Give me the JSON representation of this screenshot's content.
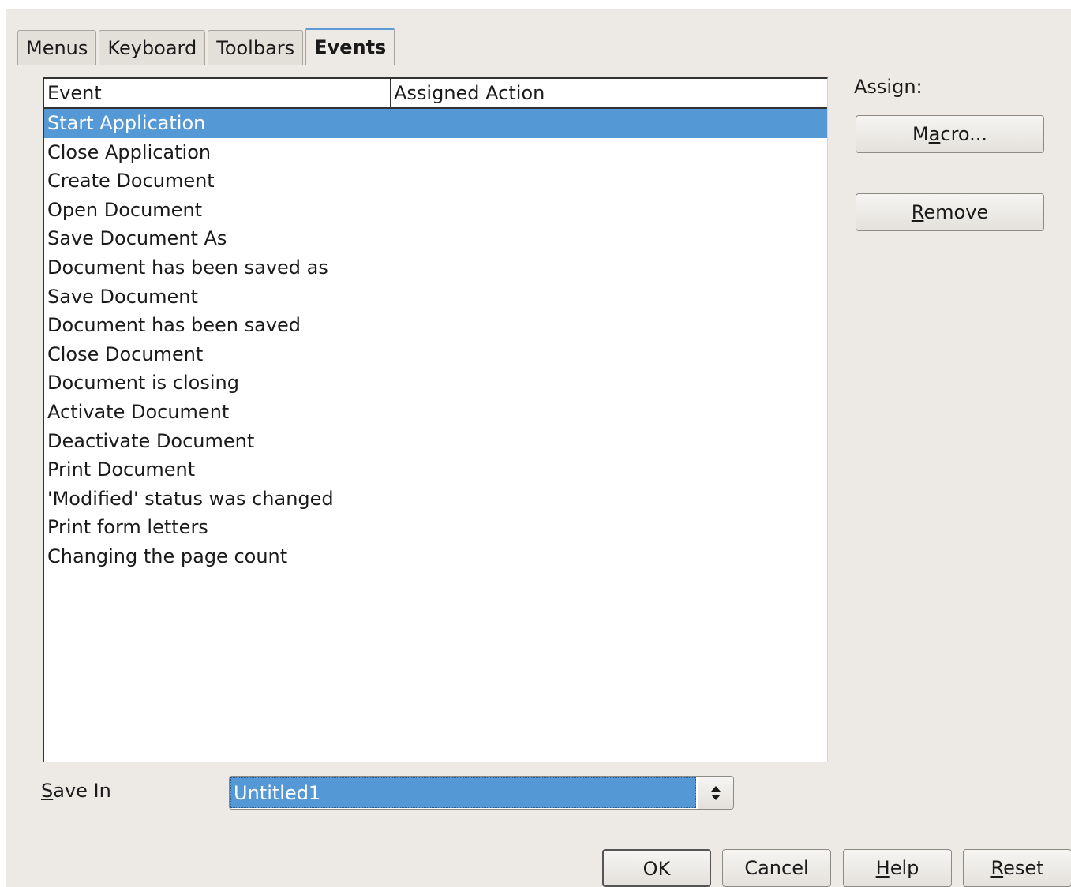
{
  "tabs": [
    {
      "label": "Menus",
      "active": false
    },
    {
      "label": "Keyboard",
      "active": false
    },
    {
      "label": "Toolbars",
      "active": false
    },
    {
      "label": "Events",
      "active": true
    }
  ],
  "event_list": {
    "columns": [
      "Event",
      "Assigned Action"
    ],
    "rows": [
      {
        "event": "Start Application",
        "action": "",
        "selected": true
      },
      {
        "event": "Close Application",
        "action": ""
      },
      {
        "event": "Create Document",
        "action": ""
      },
      {
        "event": "Open Document",
        "action": ""
      },
      {
        "event": "Save Document As",
        "action": ""
      },
      {
        "event": "Document has been saved as",
        "action": ""
      },
      {
        "event": "Save Document",
        "action": ""
      },
      {
        "event": "Document has been saved",
        "action": ""
      },
      {
        "event": "Close Document",
        "action": ""
      },
      {
        "event": "Document is closing",
        "action": ""
      },
      {
        "event": "Activate Document",
        "action": ""
      },
      {
        "event": "Deactivate Document",
        "action": ""
      },
      {
        "event": "Print Document",
        "action": ""
      },
      {
        "event": "'Modified' status was changed",
        "action": ""
      },
      {
        "event": "Print form letters",
        "action": ""
      },
      {
        "event": "Changing the page count",
        "action": ""
      }
    ]
  },
  "assign": {
    "label": "Assign:",
    "macro_pre": "M",
    "macro_u": "a",
    "macro_post": "cro...",
    "remove_u": "R",
    "remove_post": "emove"
  },
  "save_in": {
    "label_u": "S",
    "label_post": "ave In",
    "value": "Untitled1"
  },
  "footer": {
    "ok": "OK",
    "cancel": "Cancel",
    "help_u": "H",
    "help_post": "elp",
    "reset_u": "R",
    "reset_post": "eset"
  },
  "colors": {
    "selection": "#5598d6",
    "dialog_bg": "#edeae6",
    "active_tab_accent": "#5e9bd6"
  }
}
